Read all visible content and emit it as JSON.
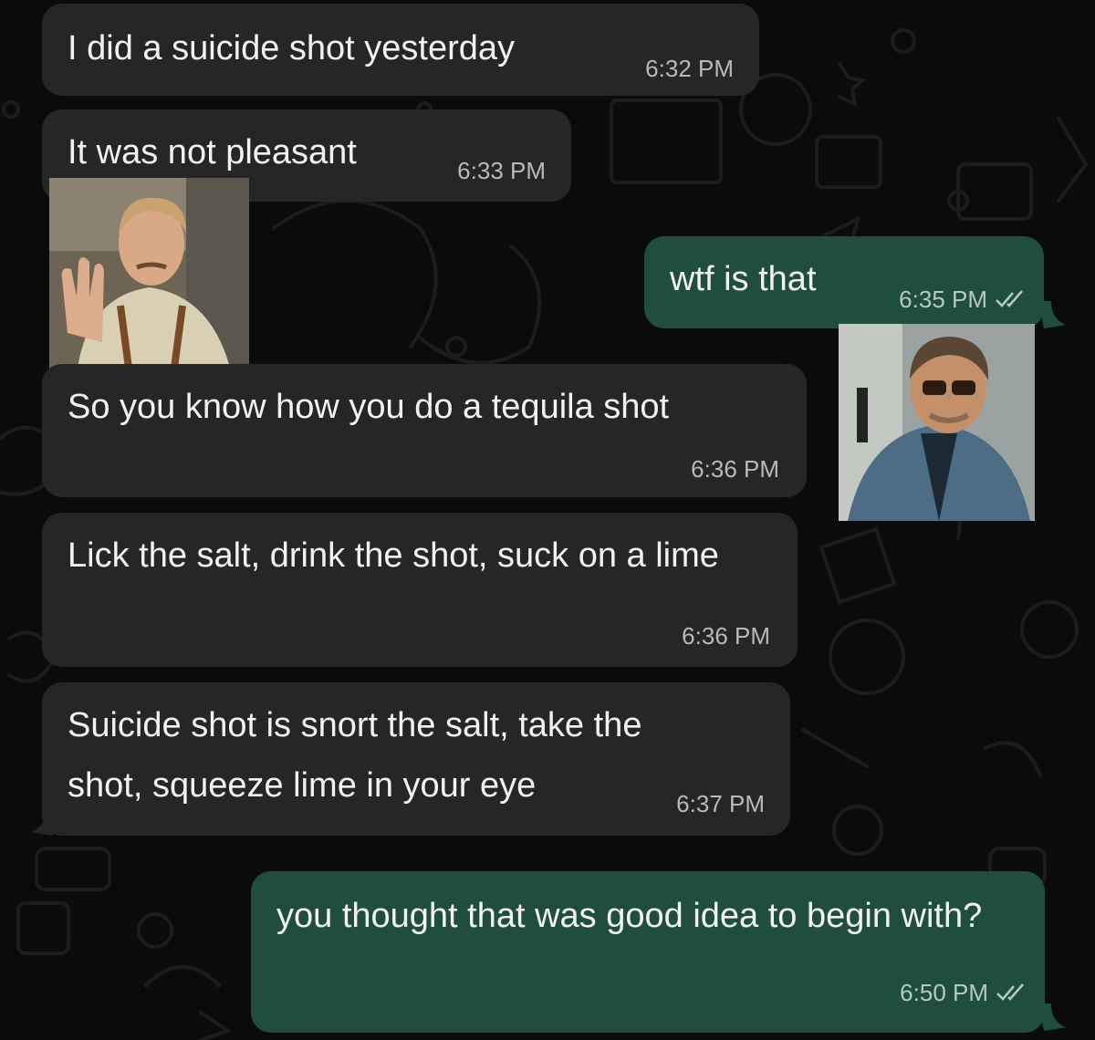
{
  "conversation": {
    "messages": [
      {
        "dir": "in",
        "text": "I did a suicide shot yesterday",
        "time": "6:32 PM"
      },
      {
        "dir": "in",
        "text": "It was not pleasant",
        "time": "6:33 PM"
      },
      {
        "dir": "in",
        "type": "sticker",
        "subject": "man-waving-sticker"
      },
      {
        "dir": "out",
        "text": "wtf is that",
        "time": "6:35 PM",
        "status": "read"
      },
      {
        "dir": "out",
        "type": "sticker",
        "subject": "man-sunglasses-sticker"
      },
      {
        "dir": "in",
        "text": "So you know how you do a tequila shot",
        "time": "6:36 PM"
      },
      {
        "dir": "in",
        "text": "Lick the salt, drink the shot, suck on a lime",
        "time": "6:36 PM"
      },
      {
        "dir": "in",
        "text": "Suicide shot is snort the salt, take the shot, squeeze lime in your eye",
        "time": "6:37 PM"
      },
      {
        "dir": "out",
        "text": "you thought that was good idea to begin with?",
        "time": "6:50 PM",
        "status": "read"
      }
    ]
  },
  "colors": {
    "background": "#0b0b0b",
    "incoming_bubble": "#262626",
    "outgoing_bubble": "#1f4e3d",
    "text": "#f2f2f2",
    "timestamp": "#b9b9b9"
  }
}
